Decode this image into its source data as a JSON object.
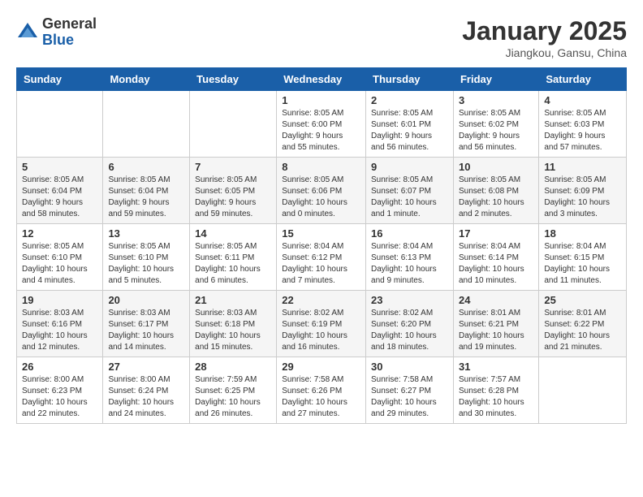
{
  "header": {
    "logo_general": "General",
    "logo_blue": "Blue",
    "month_title": "January 2025",
    "location": "Jiangkou, Gansu, China"
  },
  "days_of_week": [
    "Sunday",
    "Monday",
    "Tuesday",
    "Wednesday",
    "Thursday",
    "Friday",
    "Saturday"
  ],
  "weeks": [
    [
      {
        "day": "",
        "info": ""
      },
      {
        "day": "",
        "info": ""
      },
      {
        "day": "",
        "info": ""
      },
      {
        "day": "1",
        "info": "Sunrise: 8:05 AM\nSunset: 6:00 PM\nDaylight: 9 hours\nand 55 minutes."
      },
      {
        "day": "2",
        "info": "Sunrise: 8:05 AM\nSunset: 6:01 PM\nDaylight: 9 hours\nand 56 minutes."
      },
      {
        "day": "3",
        "info": "Sunrise: 8:05 AM\nSunset: 6:02 PM\nDaylight: 9 hours\nand 56 minutes."
      },
      {
        "day": "4",
        "info": "Sunrise: 8:05 AM\nSunset: 6:03 PM\nDaylight: 9 hours\nand 57 minutes."
      }
    ],
    [
      {
        "day": "5",
        "info": "Sunrise: 8:05 AM\nSunset: 6:04 PM\nDaylight: 9 hours\nand 58 minutes."
      },
      {
        "day": "6",
        "info": "Sunrise: 8:05 AM\nSunset: 6:04 PM\nDaylight: 9 hours\nand 59 minutes."
      },
      {
        "day": "7",
        "info": "Sunrise: 8:05 AM\nSunset: 6:05 PM\nDaylight: 9 hours\nand 59 minutes."
      },
      {
        "day": "8",
        "info": "Sunrise: 8:05 AM\nSunset: 6:06 PM\nDaylight: 10 hours\nand 0 minutes."
      },
      {
        "day": "9",
        "info": "Sunrise: 8:05 AM\nSunset: 6:07 PM\nDaylight: 10 hours\nand 1 minute."
      },
      {
        "day": "10",
        "info": "Sunrise: 8:05 AM\nSunset: 6:08 PM\nDaylight: 10 hours\nand 2 minutes."
      },
      {
        "day": "11",
        "info": "Sunrise: 8:05 AM\nSunset: 6:09 PM\nDaylight: 10 hours\nand 3 minutes."
      }
    ],
    [
      {
        "day": "12",
        "info": "Sunrise: 8:05 AM\nSunset: 6:10 PM\nDaylight: 10 hours\nand 4 minutes."
      },
      {
        "day": "13",
        "info": "Sunrise: 8:05 AM\nSunset: 6:10 PM\nDaylight: 10 hours\nand 5 minutes."
      },
      {
        "day": "14",
        "info": "Sunrise: 8:05 AM\nSunset: 6:11 PM\nDaylight: 10 hours\nand 6 minutes."
      },
      {
        "day": "15",
        "info": "Sunrise: 8:04 AM\nSunset: 6:12 PM\nDaylight: 10 hours\nand 7 minutes."
      },
      {
        "day": "16",
        "info": "Sunrise: 8:04 AM\nSunset: 6:13 PM\nDaylight: 10 hours\nand 9 minutes."
      },
      {
        "day": "17",
        "info": "Sunrise: 8:04 AM\nSunset: 6:14 PM\nDaylight: 10 hours\nand 10 minutes."
      },
      {
        "day": "18",
        "info": "Sunrise: 8:04 AM\nSunset: 6:15 PM\nDaylight: 10 hours\nand 11 minutes."
      }
    ],
    [
      {
        "day": "19",
        "info": "Sunrise: 8:03 AM\nSunset: 6:16 PM\nDaylight: 10 hours\nand 12 minutes."
      },
      {
        "day": "20",
        "info": "Sunrise: 8:03 AM\nSunset: 6:17 PM\nDaylight: 10 hours\nand 14 minutes."
      },
      {
        "day": "21",
        "info": "Sunrise: 8:03 AM\nSunset: 6:18 PM\nDaylight: 10 hours\nand 15 minutes."
      },
      {
        "day": "22",
        "info": "Sunrise: 8:02 AM\nSunset: 6:19 PM\nDaylight: 10 hours\nand 16 minutes."
      },
      {
        "day": "23",
        "info": "Sunrise: 8:02 AM\nSunset: 6:20 PM\nDaylight: 10 hours\nand 18 minutes."
      },
      {
        "day": "24",
        "info": "Sunrise: 8:01 AM\nSunset: 6:21 PM\nDaylight: 10 hours\nand 19 minutes."
      },
      {
        "day": "25",
        "info": "Sunrise: 8:01 AM\nSunset: 6:22 PM\nDaylight: 10 hours\nand 21 minutes."
      }
    ],
    [
      {
        "day": "26",
        "info": "Sunrise: 8:00 AM\nSunset: 6:23 PM\nDaylight: 10 hours\nand 22 minutes."
      },
      {
        "day": "27",
        "info": "Sunrise: 8:00 AM\nSunset: 6:24 PM\nDaylight: 10 hours\nand 24 minutes."
      },
      {
        "day": "28",
        "info": "Sunrise: 7:59 AM\nSunset: 6:25 PM\nDaylight: 10 hours\nand 26 minutes."
      },
      {
        "day": "29",
        "info": "Sunrise: 7:58 AM\nSunset: 6:26 PM\nDaylight: 10 hours\nand 27 minutes."
      },
      {
        "day": "30",
        "info": "Sunrise: 7:58 AM\nSunset: 6:27 PM\nDaylight: 10 hours\nand 29 minutes."
      },
      {
        "day": "31",
        "info": "Sunrise: 7:57 AM\nSunset: 6:28 PM\nDaylight: 10 hours\nand 30 minutes."
      },
      {
        "day": "",
        "info": ""
      }
    ]
  ]
}
